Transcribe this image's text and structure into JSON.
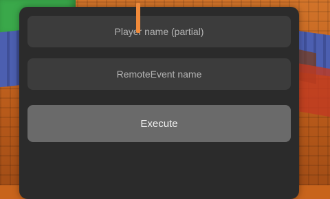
{
  "form": {
    "player_name_placeholder": "Player name (partial)",
    "remote_event_placeholder": "RemoteEvent name",
    "execute_label": "Execute"
  },
  "colors": {
    "panel": "#2b2b2b",
    "field": "#3c3c3c",
    "button": "#6a6a6a",
    "caret": "#f08a3a"
  }
}
